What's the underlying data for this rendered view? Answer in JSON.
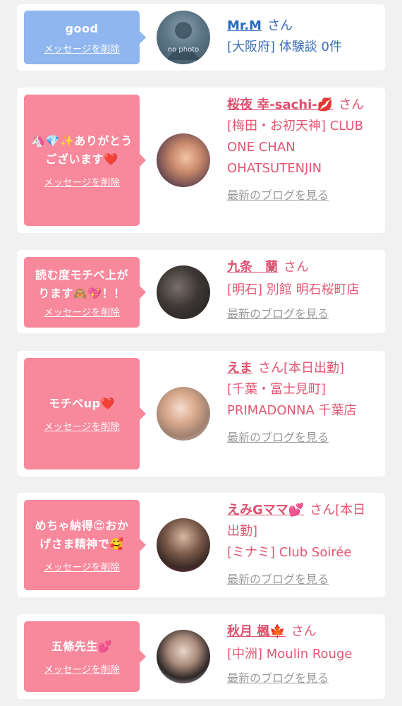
{
  "delete_label": "メッセージを削除",
  "blog_label": "最新のブログを見る",
  "san": "さん",
  "cards": [
    {
      "message": "good",
      "name": "Mr.M",
      "extra": "",
      "shop": "[大阪府] 体験談 0件",
      "avatar_text": "no photo",
      "has_blog": false
    },
    {
      "message": "🦄💎✨ありがとうございます❤️",
      "name": "桜夜 幸-sachi-💋",
      "extra": "",
      "shop": "[梅田・お初天神] CLUB ONE CHAN OHATSUTENJIN",
      "has_blog": true
    },
    {
      "message": "読む度モチベ上がります🙈💖！！",
      "name": "九条　蘭",
      "extra": "",
      "shop": "[明石] 別館 明石桜町店",
      "has_blog": true
    },
    {
      "message": "モチベup❤️",
      "name": "えま",
      "extra": "[本日出勤]",
      "shop": "[千葉・富士見町] PRIMADONNA 千葉店",
      "has_blog": true
    },
    {
      "message": "めちゃ納得😍おかげさま精神で🥰",
      "name": "えみGママ💕",
      "extra": "[本日出勤]",
      "shop": "[ミナミ] Club Soirée",
      "has_blog": true
    },
    {
      "message": "五條先生💕",
      "name": "秋月 楓🍁",
      "extra": "",
      "shop": "[中洲] Moulin Rouge",
      "has_blog": true
    }
  ]
}
